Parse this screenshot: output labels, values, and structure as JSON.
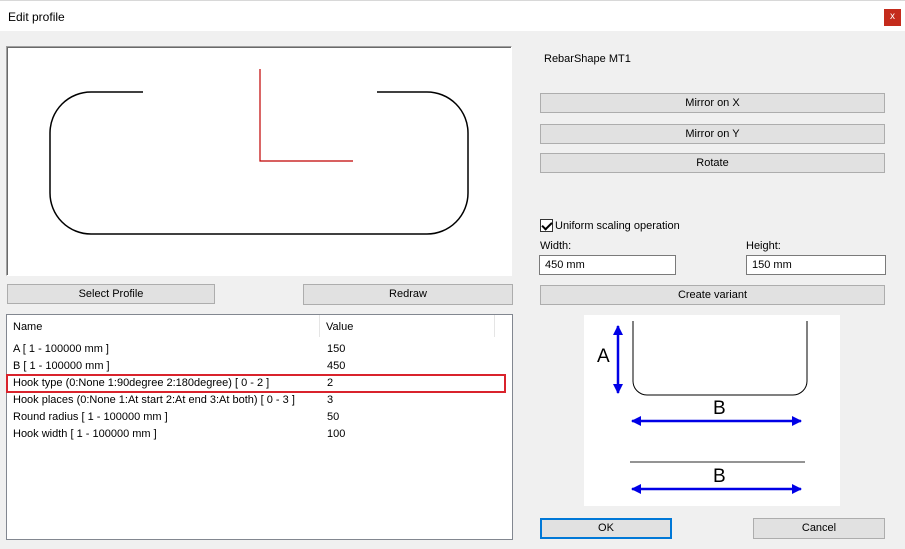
{
  "window": {
    "title": "Edit profile",
    "close_glyph": "x"
  },
  "buttons": {
    "select_profile": "Select Profile",
    "redraw": "Redraw",
    "mirror_x": "Mirror on X",
    "mirror_y": "Mirror on Y",
    "rotate": "Rotate",
    "create_variant": "Create variant",
    "ok": "OK",
    "cancel": "Cancel"
  },
  "shape_name": "RebarShape MT1",
  "uniform_scaling": {
    "label": "Uniform scaling operation",
    "checked": true
  },
  "width": {
    "label": "Width:",
    "value": "450 mm"
  },
  "height": {
    "label": "Height:",
    "value": "150 mm"
  },
  "grid": {
    "headers": [
      "Name",
      "Value"
    ],
    "rows": [
      {
        "name": "A [ 1 - 100000 mm ]",
        "value": "150"
      },
      {
        "name": "B [ 1 - 100000 mm ]",
        "value": "450"
      },
      {
        "name": "Hook type (0:None 1:90degree 2:180degree) [ 0 - 2 ]",
        "value": "2"
      },
      {
        "name": "Hook places (0:None 1:At start 2:At end 3:At both) [ 0 - 3 ]",
        "value": "3"
      },
      {
        "name": "Round radius [ 1 - 100000 mm ]",
        "value": "50"
      },
      {
        "name": "Hook width [ 1 - 100000 mm ]",
        "value": "100"
      }
    ],
    "highlighted_row": 2
  },
  "diagram": {
    "label_a": "A",
    "label_b": "B",
    "label_b2": "B"
  },
  "colors": {
    "highlight": "#d9232c",
    "axis_red": "#c00000",
    "arrow_blue": "#0000e6",
    "ok_border": "#0078d7"
  }
}
